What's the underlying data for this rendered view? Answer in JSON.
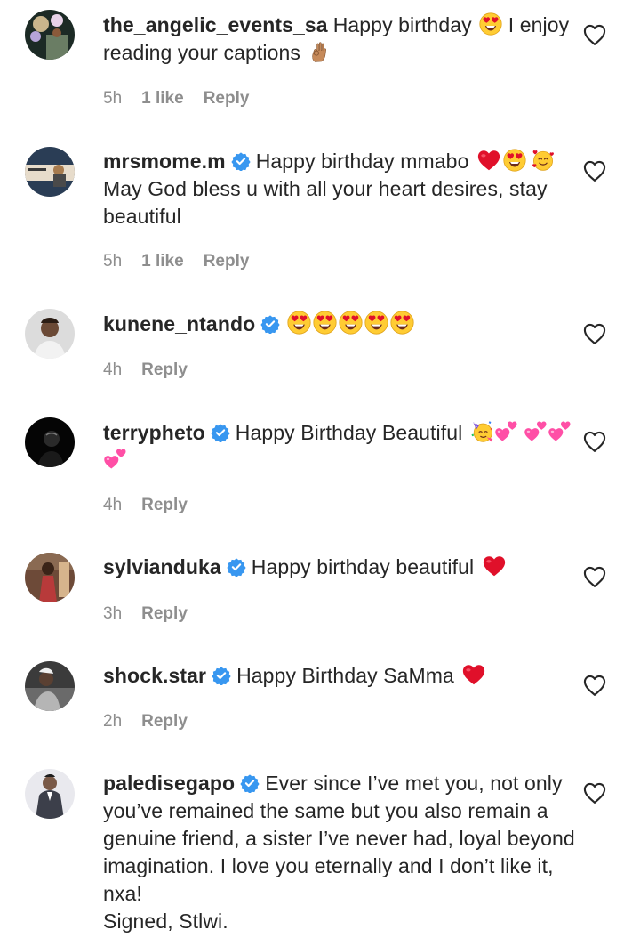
{
  "comments": [
    {
      "username": "the_angelic_events_sa",
      "verified": false,
      "text": "Happy birthday",
      "text2": "I enjoy reading your captions",
      "time": "5h",
      "likes": "1 like",
      "reply": "Reply",
      "avatar_colors": [
        "#1c2a25",
        "#6a7d64",
        "#c9b58c"
      ]
    },
    {
      "username": "mrsmome.m",
      "verified": true,
      "text": "Happy birthday mmabo",
      "text2": "May God bless u with all your heart desires, stay beautiful",
      "time": "5h",
      "likes": "1 like",
      "reply": "Reply",
      "avatar_colors": [
        "#2a3d55",
        "#e7dccb",
        "#a87c4f"
      ]
    },
    {
      "username": "kunene_ntando",
      "verified": true,
      "text": "",
      "time": "4h",
      "reply": "Reply",
      "avatar_colors": [
        "#dcdcdc",
        "#6b4a36",
        "#f2f2f2"
      ]
    },
    {
      "username": "terrypheto",
      "verified": true,
      "text": "Happy Birthday Beautiful",
      "time": "4h",
      "reply": "Reply",
      "avatar_colors": [
        "#050505",
        "#2a2a2a",
        "#7a7a7a"
      ]
    },
    {
      "username": "sylvianduka",
      "verified": true,
      "text": "Happy birthday beautiful",
      "time": "3h",
      "reply": "Reply",
      "avatar_colors": [
        "#6d4a38",
        "#b83a3a",
        "#d6b48c"
      ]
    },
    {
      "username": "shock.star",
      "verified": true,
      "text": "Happy Birthday SaMma",
      "time": "2h",
      "reply": "Reply",
      "avatar_colors": [
        "#3b3b3b",
        "#b5b5b5",
        "#f0f0f0"
      ]
    },
    {
      "username": "paledisegapo",
      "verified": true,
      "text": "Ever since I’ve met you, not only you’ve remained the same but you also remain a genuine friend, a sister I’ve never had, loyal beyond imagination. I love you eternally and I don’t like it, nxa!",
      "text2": "Signed, Stlwi.",
      "avatar_colors": [
        "#e9e9ee",
        "#3c3f4a",
        "#7a5a48"
      ]
    }
  ],
  "icons": {
    "like": "heart-outline-icon",
    "verified": "verified-badge-icon",
    "emoji_heart_eyes": "heart-eyes-emoji",
    "emoji_ok_hand": "ok-hand-emoji",
    "emoji_red_heart": "red-heart-emoji",
    "emoji_smiling_hearts": "smiling-face-with-hearts-emoji",
    "emoji_party": "partying-face-emoji",
    "emoji_two_hearts": "two-hearts-emoji"
  },
  "colors": {
    "text": "#262626",
    "meta": "#8e8e8e",
    "verified_blue": "#3897f0",
    "heart_red": "#e0102a",
    "emoji_yellow": "#ffcc33"
  }
}
